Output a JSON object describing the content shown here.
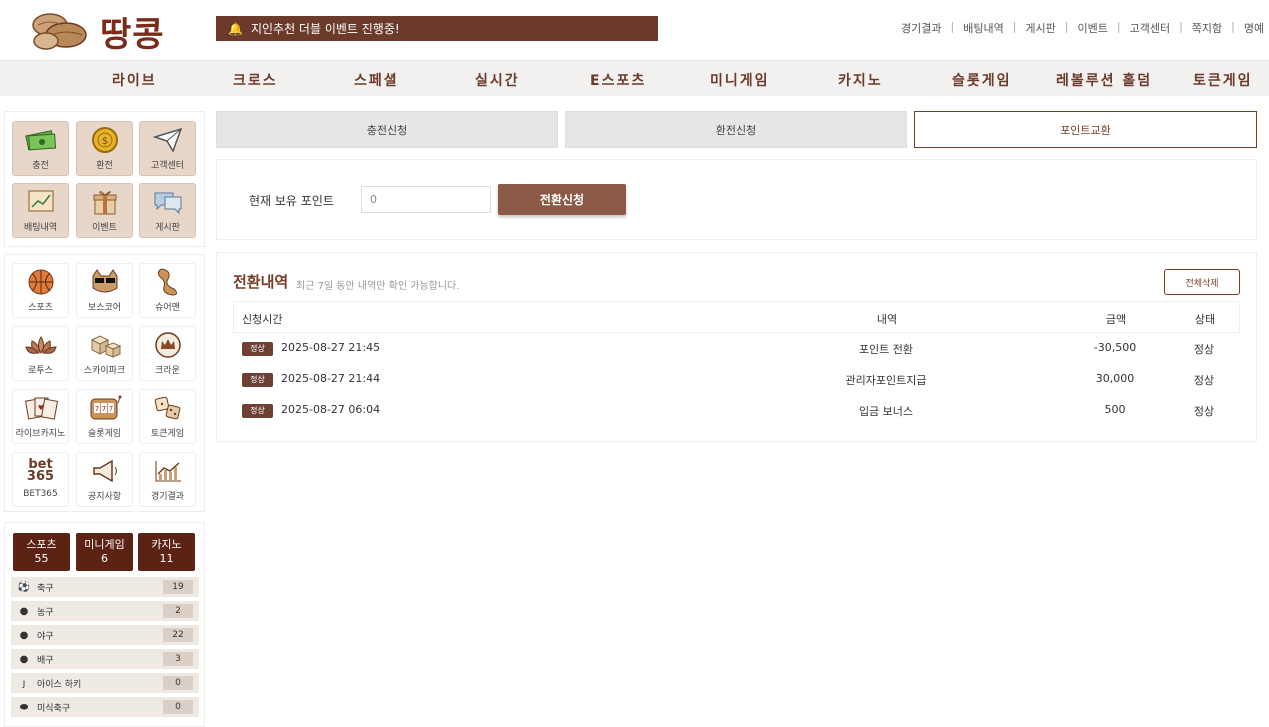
{
  "header": {
    "logo_text": "땅콩",
    "notice": "지인추천 더블 이벤트 진행중!",
    "top_links": [
      "경기결과",
      "배팅내역",
      "게시판",
      "이벤트",
      "고객센터",
      "쪽지함",
      "명예"
    ]
  },
  "main_nav": [
    "라이브",
    "크로스",
    "스페셜",
    "실시간",
    "E스포츠",
    "미니게임",
    "카지노",
    "슬롯게임",
    "레볼루션 홀덤",
    "토큰게임"
  ],
  "quick_menu": [
    {
      "label": "충전",
      "icon": "cash-icon"
    },
    {
      "label": "환전",
      "icon": "coin-icon"
    },
    {
      "label": "고객센터",
      "icon": "paper-plane-icon"
    },
    {
      "label": "배팅내역",
      "icon": "chart-board-icon"
    },
    {
      "label": "이벤트",
      "icon": "gift-icon"
    },
    {
      "label": "게시판",
      "icon": "chat-bubble-icon"
    }
  ],
  "game_menu": [
    {
      "label": "스포츠",
      "icon": "basketball-icon"
    },
    {
      "label": "보스코어",
      "icon": "sunglasses-cat-icon"
    },
    {
      "label": "슈어맨",
      "icon": "peanut-icon"
    },
    {
      "label": "로투스",
      "icon": "lotus-icon"
    },
    {
      "label": "스카이파크",
      "icon": "boxes-icon"
    },
    {
      "label": "크라운",
      "icon": "crown-icon"
    },
    {
      "label": "라이브카지노",
      "icon": "cards-icon"
    },
    {
      "label": "슬롯게임",
      "icon": "slot-machine-icon"
    },
    {
      "label": "토큰게임",
      "icon": "dice-icon"
    },
    {
      "label": "BET365",
      "icon": "bet365-logo",
      "logo_text": [
        "bet",
        "365"
      ]
    },
    {
      "label": "공지사항",
      "icon": "megaphone-icon"
    },
    {
      "label": "경기결과",
      "icon": "line-chart-icon"
    }
  ],
  "categories": [
    {
      "name": "스포츠",
      "count": "55"
    },
    {
      "name": "미니게임",
      "count": "6"
    },
    {
      "name": "카지노",
      "count": "11"
    }
  ],
  "sports": [
    {
      "name": "축구",
      "count": "19",
      "icon": "soccer-icon"
    },
    {
      "name": "농구",
      "count": "2",
      "icon": "basketball-icon"
    },
    {
      "name": "야구",
      "count": "22",
      "icon": "baseball-icon"
    },
    {
      "name": "배구",
      "count": "3",
      "icon": "volleyball-icon"
    },
    {
      "name": "아이스 하키",
      "count": "0",
      "icon": "hockey-icon"
    },
    {
      "name": "미식축구",
      "count": "0",
      "icon": "football-icon"
    }
  ],
  "tabs": [
    {
      "label": "충전신청",
      "active": false
    },
    {
      "label": "환전신청",
      "active": false
    },
    {
      "label": "포인트교환",
      "active": true
    }
  ],
  "points": {
    "label": "현재 보유 포인트",
    "value": "0",
    "button": "전환신청"
  },
  "history": {
    "title": "전환내역",
    "subtitle": "최근 7일 동안 내역만 확인 가능합니다.",
    "delete_all": "전체삭제",
    "columns": [
      "신청시간",
      "내역",
      "금액",
      "상태"
    ],
    "rows": [
      {
        "badge": "정상",
        "time": "2025-08-27 21:45",
        "desc": "포인트 전환",
        "amount": "-30,500",
        "status": "정상"
      },
      {
        "badge": "정상",
        "time": "2025-08-27 21:44",
        "desc": "관리자포인트지급",
        "amount": "30,000",
        "status": "정상"
      },
      {
        "badge": "정상",
        "time": "2025-08-27 06:04",
        "desc": "입금 보너스",
        "amount": "500",
        "status": "정상"
      }
    ]
  },
  "colors": {
    "brand_brown": "#6b3a2a",
    "dark_brown": "#5c2214",
    "button_brown": "#8b5a46",
    "tile_bg": "#e8d6c9"
  }
}
